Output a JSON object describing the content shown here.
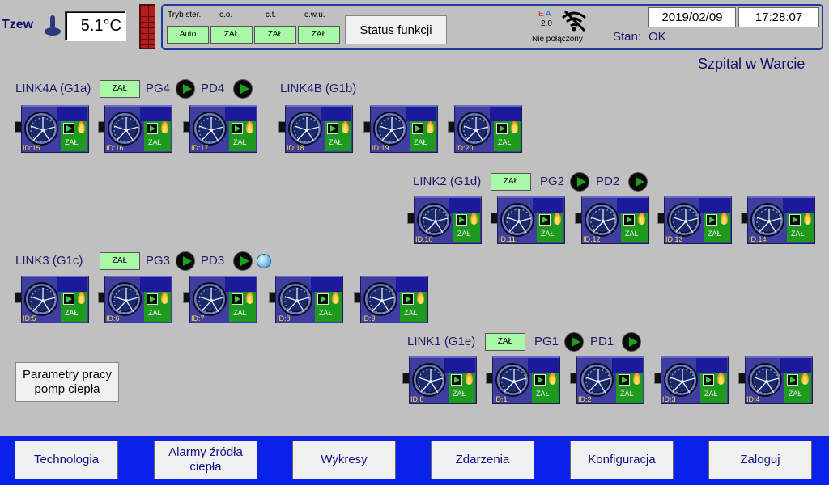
{
  "header": {
    "tzew_label": "Tzew",
    "tzew_value": "5.1°C",
    "mode_labels": {
      "tryb": "Tryb ster.",
      "co": "c.o.",
      "ct": "c.t.",
      "cwu": "c.w.u."
    },
    "mode_values": {
      "tryb": "Auto",
      "co": "ZAŁ",
      "ct": "ZAŁ",
      "cwu": "ZAŁ"
    },
    "status_button": "Status funkcji",
    "ea_e": "E",
    "ea_a": "A",
    "version": "2.0",
    "connection": "Nie połączony",
    "date": "2019/02/09",
    "time": "17:28:07",
    "stan_label": "Stan:",
    "stan_value": "OK",
    "site_name": "Szpital w Warcie"
  },
  "links": {
    "link4a": {
      "title": "LINK4A (G1a)",
      "status": "ZAŁ",
      "pg": "PG4",
      "pd": "PD4"
    },
    "link4b": {
      "title": "LINK4B (G1b)"
    },
    "link2": {
      "title": "LINK2 (G1d)",
      "status": "ZAŁ",
      "pg": "PG2",
      "pd": "PD2"
    },
    "link3": {
      "title": "LINK3 (G1c)",
      "status": "ZAŁ",
      "pg": "PG3",
      "pd": "PD3"
    },
    "link1": {
      "title": "LINK1 (G1e)",
      "status": "ZAŁ",
      "pg": "PG1",
      "pd": "PD1"
    }
  },
  "units": [
    {
      "id": "ID:15",
      "status": "ZAŁ"
    },
    {
      "id": "ID:16",
      "status": "ZAŁ"
    },
    {
      "id": "ID:17",
      "status": "ZAŁ"
    },
    {
      "id": "ID:18",
      "status": "ZAŁ"
    },
    {
      "id": "ID:19",
      "status": "ZAŁ"
    },
    {
      "id": "ID:20",
      "status": "ZAŁ"
    },
    {
      "id": "ID:10",
      "status": "ZAŁ"
    },
    {
      "id": "ID:11",
      "status": "ZAŁ"
    },
    {
      "id": "ID:12",
      "status": "ZAŁ"
    },
    {
      "id": "ID:13",
      "status": "ZAŁ"
    },
    {
      "id": "ID:14",
      "status": "ZAŁ"
    },
    {
      "id": "ID:5",
      "status": "ZAŁ"
    },
    {
      "id": "ID:6",
      "status": "ZAŁ"
    },
    {
      "id": "ID:7",
      "status": "ZAŁ"
    },
    {
      "id": "ID:8",
      "status": "ZAŁ"
    },
    {
      "id": "ID:9",
      "status": "ZAŁ"
    },
    {
      "id": "ID:0",
      "status": "ZAŁ"
    },
    {
      "id": "ID:1",
      "status": "ZAŁ"
    },
    {
      "id": "ID:2",
      "status": "ZAŁ"
    },
    {
      "id": "ID:3",
      "status": "ZAŁ"
    },
    {
      "id": "ID:4",
      "status": "ZAŁ"
    }
  ],
  "params_button": "Parametry pracy pomp ciepła",
  "nav": [
    {
      "label": "Technologia"
    },
    {
      "label": "Alarmy źródła ciepła"
    },
    {
      "label": "Wykresy"
    },
    {
      "label": "Zdarzenia"
    },
    {
      "label": "Konfiguracja"
    },
    {
      "label": "Zaloguj"
    }
  ],
  "colors": {
    "background": "#c0c0c0",
    "nav_bar": "#0a22e8",
    "status_on": "#a8f8a8",
    "unit_body": "#3e3ea0",
    "unit_active": "#1e9a1e"
  }
}
